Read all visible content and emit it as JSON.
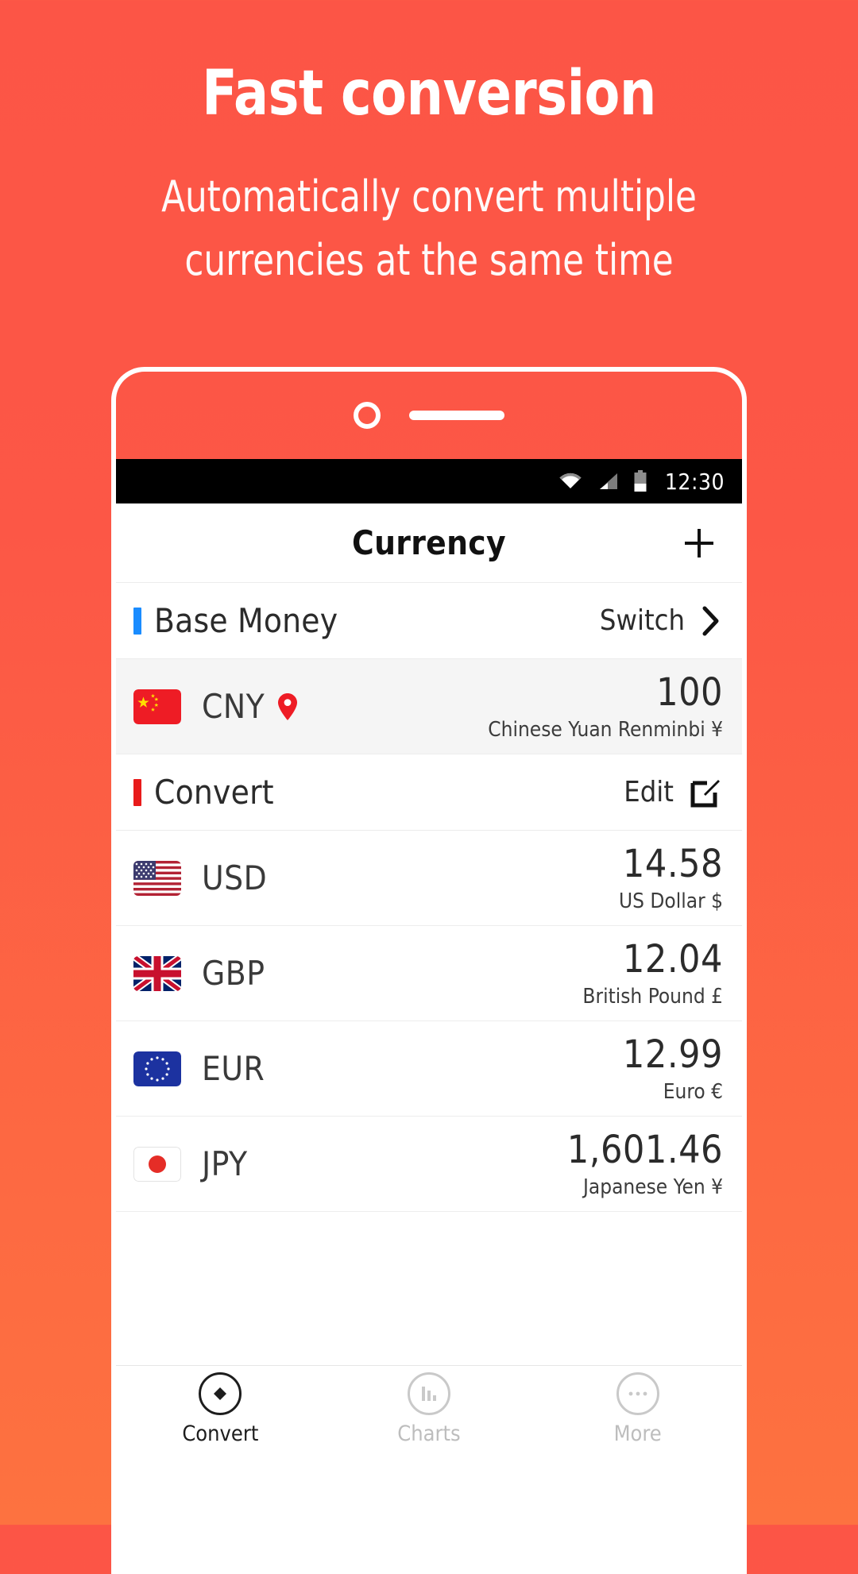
{
  "promo": {
    "title": "Fast conversion",
    "subtitle_line1": "Automatically convert multiple",
    "subtitle_line2": "currencies at the same time"
  },
  "colors": {
    "bg_top": "#fc5546",
    "bg_bottom": "#fd7240",
    "base_accent": "#1a8cff",
    "convert_accent": "#e81b1b",
    "frame": "#ffffff"
  },
  "statusbar": {
    "wifi_icon": "wifi-icon",
    "signal_icon": "cell-signal-icon",
    "battery_icon": "battery-icon",
    "time": "12:30"
  },
  "appbar": {
    "title": "Currency",
    "add_label": "+",
    "add_icon": "plus-icon"
  },
  "sections": {
    "base": {
      "label": "Base Money",
      "action": "Switch",
      "action_icon": "chevron-right-icon",
      "accent": "#1a8cff"
    },
    "convert": {
      "label": "Convert",
      "action": "Edit",
      "action_icon": "edit-square-icon",
      "accent": "#e81b1b"
    }
  },
  "base_currency": {
    "code": "CNY",
    "flag_icon": "flag-china-icon",
    "pin_icon": "location-pin-icon",
    "amount": "100",
    "name": "Chinese Yuan Renminbi ¥"
  },
  "convert_currencies": [
    {
      "code": "USD",
      "flag_icon": "flag-usa-icon",
      "amount": "14.58",
      "name": "US Dollar $"
    },
    {
      "code": "GBP",
      "flag_icon": "flag-uk-icon",
      "amount": "12.04",
      "name": "British Pound £"
    },
    {
      "code": "EUR",
      "flag_icon": "flag-eu-icon",
      "amount": "12.99",
      "name": "Euro €"
    },
    {
      "code": "JPY",
      "flag_icon": "flag-japan-icon",
      "amount": "1,601.46",
      "name": "Japanese Yen ¥"
    }
  ],
  "tabs": [
    {
      "label": "Convert",
      "icon": "diamond-icon",
      "active": true
    },
    {
      "label": "Charts",
      "icon": "bar-chart-icon",
      "active": false
    },
    {
      "label": "More",
      "icon": "ellipsis-icon",
      "active": false
    }
  ]
}
